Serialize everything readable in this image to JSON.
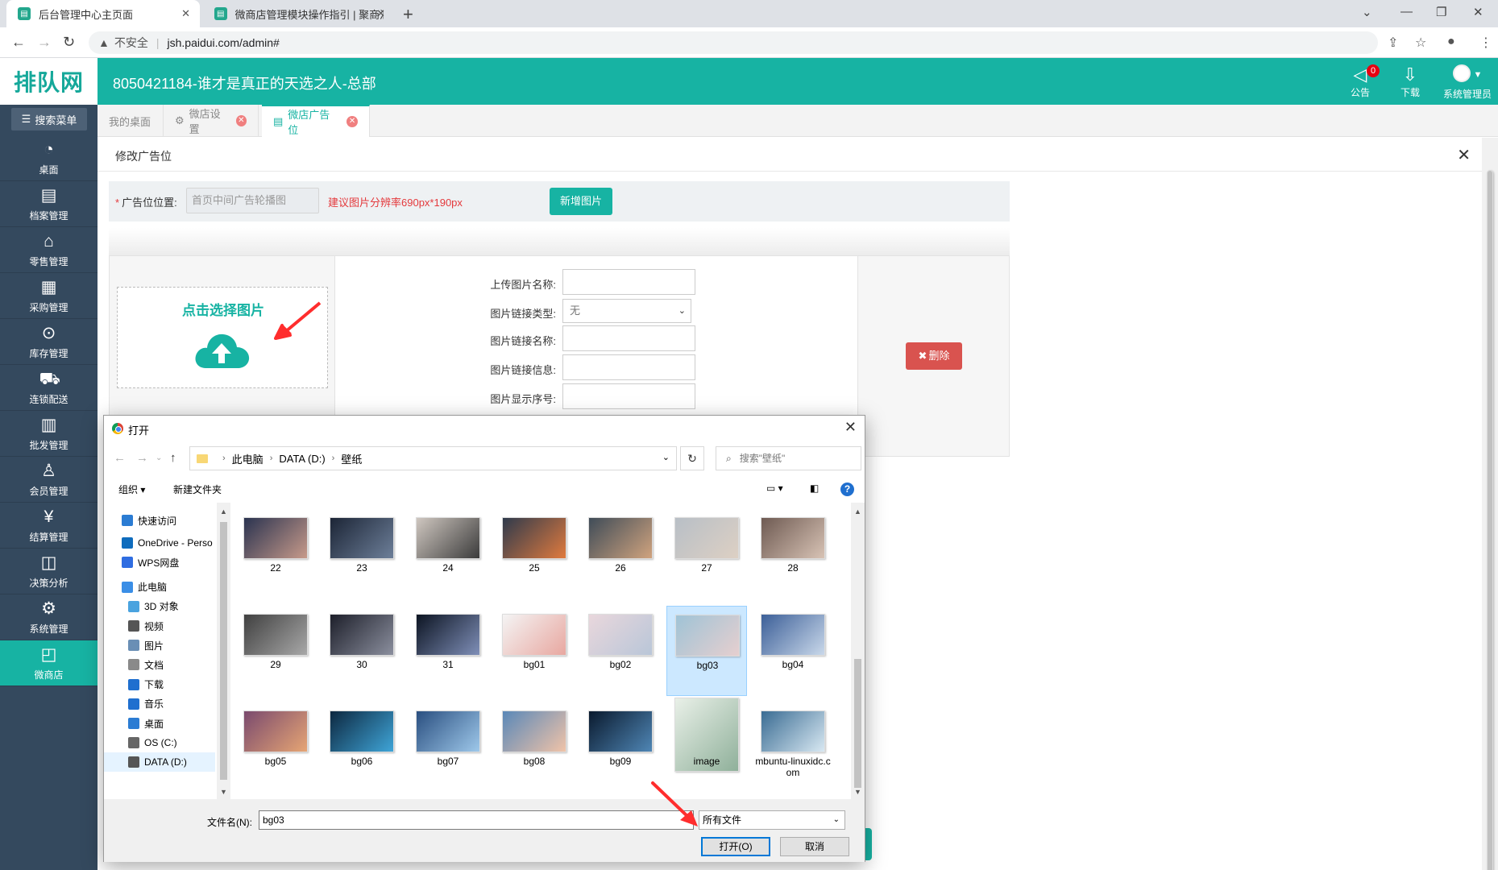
{
  "browser": {
    "tabs": [
      {
        "title": "后台管理中心主页面",
        "active": true
      },
      {
        "title": "微商店管理模块操作指引 | 聚商汇",
        "active": false
      }
    ],
    "new_tab": "+",
    "address": {
      "insecure_label": "不安全",
      "url": "jsh.paidui.com/admin#"
    }
  },
  "app": {
    "logo": "排队网",
    "store_title": "8050421184-谁才是真正的天选之人-总部",
    "header": {
      "notice_label": "公告",
      "notice_count": "0",
      "download_label": "下载",
      "user_label": "系统管理员"
    }
  },
  "sidebar": {
    "search_label": "搜索菜单",
    "items": [
      {
        "label": "桌面",
        "icon": "dashboard-icon",
        "glyph": "◔"
      },
      {
        "label": "档案管理",
        "icon": "archive-icon",
        "glyph": "▤"
      },
      {
        "label": "零售管理",
        "icon": "store-icon",
        "glyph": "⌂"
      },
      {
        "label": "采购管理",
        "icon": "purchase-icon",
        "glyph": "▦"
      },
      {
        "label": "库存管理",
        "icon": "inventory-icon",
        "glyph": "⊙"
      },
      {
        "label": "连锁配送",
        "icon": "delivery-icon",
        "glyph": "⛟"
      },
      {
        "label": "批发管理",
        "icon": "wholesale-icon",
        "glyph": "▥"
      },
      {
        "label": "会员管理",
        "icon": "member-icon",
        "glyph": "♙"
      },
      {
        "label": "结算管理",
        "icon": "settlement-icon",
        "glyph": "¥"
      },
      {
        "label": "决策分析",
        "icon": "analysis-icon",
        "glyph": "◫"
      },
      {
        "label": "系统管理",
        "icon": "settings-icon",
        "glyph": "⚙"
      },
      {
        "label": "微商店",
        "icon": "microstore-icon",
        "glyph": "◰"
      }
    ]
  },
  "content_tabs": [
    {
      "label": "我的桌面",
      "closable": false,
      "icon": ""
    },
    {
      "label": "微店设置",
      "closable": true,
      "icon": "⚙"
    },
    {
      "label": "微店广告位",
      "closable": true,
      "icon": "▤"
    }
  ],
  "panel": {
    "title": "修改广告位",
    "position_label": "广告位位置:",
    "position_value": "首页中间广告轮播图",
    "size_hint": "建议图片分辨率690px*190px",
    "add_button": "新增图片",
    "upload_prompt": "点击选择图片",
    "fields": [
      {
        "label": "上传图片名称:",
        "type": "input",
        "value": ""
      },
      {
        "label": "图片链接类型:",
        "type": "select",
        "value": "无"
      },
      {
        "label": "图片链接名称:",
        "type": "input",
        "value": ""
      },
      {
        "label": "图片链接信息:",
        "type": "input",
        "value": ""
      },
      {
        "label": "图片显示序号:",
        "type": "input",
        "value": ""
      }
    ],
    "delete_button": "删除"
  },
  "dialog": {
    "title": "打开",
    "path": [
      "此电脑",
      "DATA (D:)",
      "壁纸"
    ],
    "search_placeholder": "搜索\"壁纸\"",
    "toolbar": {
      "organize": "组织 ▾",
      "new_folder": "新建文件夹"
    },
    "tree": [
      {
        "label": "快速访问",
        "indent": 1,
        "color": "#2b7cd3",
        "selected": false
      },
      {
        "label": "OneDrive - Perso",
        "indent": 1,
        "color": "#0f6cbd",
        "selected": false
      },
      {
        "label": "WPS网盘",
        "indent": 1,
        "color": "#2f6de1",
        "selected": false
      },
      {
        "label": "此电脑",
        "indent": 1,
        "color": "#3a8ee6",
        "selected": false
      },
      {
        "label": "3D 对象",
        "indent": 2,
        "color": "#4aa3df",
        "selected": false
      },
      {
        "label": "视频",
        "indent": 2,
        "color": "#555555",
        "selected": false
      },
      {
        "label": "图片",
        "indent": 2,
        "color": "#6a8fb5",
        "selected": false
      },
      {
        "label": "文档",
        "indent": 2,
        "color": "#8a8a8a",
        "selected": false
      },
      {
        "label": "下载",
        "indent": 2,
        "color": "#1f6fcf",
        "selected": false
      },
      {
        "label": "音乐",
        "indent": 2,
        "color": "#1f6fcf",
        "selected": false
      },
      {
        "label": "桌面",
        "indent": 2,
        "color": "#2b7cd3",
        "selected": false
      },
      {
        "label": "OS (C:)",
        "indent": 2,
        "color": "#666666",
        "selected": false
      },
      {
        "label": "DATA (D:)",
        "indent": 2,
        "color": "#555555",
        "selected": true
      }
    ],
    "files": [
      {
        "name": "22",
        "c1": "#2a3350",
        "c2": "#c79a8a",
        "selected": false
      },
      {
        "name": "23",
        "c1": "#1c2536",
        "c2": "#6d7f99",
        "selected": false
      },
      {
        "name": "24",
        "c1": "#cfc7c0",
        "c2": "#3b3b3b",
        "selected": false
      },
      {
        "name": "25",
        "c1": "#2f3a4c",
        "c2": "#e07a3e",
        "selected": false
      },
      {
        "name": "26",
        "c1": "#3f4c58",
        "c2": "#d0a37e",
        "selected": false
      },
      {
        "name": "27",
        "c1": "#b8bfc6",
        "c2": "#ddd0c4",
        "selected": false
      },
      {
        "name": "28",
        "c1": "#6e5a52",
        "c2": "#d8c3b5",
        "selected": false
      },
      {
        "name": "29",
        "c1": "#404040",
        "c2": "#a8a8a8",
        "selected": false
      },
      {
        "name": "30",
        "c1": "#1d1f2a",
        "c2": "#8b8f9e",
        "selected": false
      },
      {
        "name": "31",
        "c1": "#0c1422",
        "c2": "#7f8fb8",
        "selected": false
      },
      {
        "name": "bg01",
        "c1": "#f4f4f4",
        "c2": "#e8a7a0",
        "selected": false
      },
      {
        "name": "bg02",
        "c1": "#e9d7dc",
        "c2": "#b9c6d8",
        "selected": false
      },
      {
        "name": "bg03",
        "c1": "#9fc3d6",
        "c2": "#e6cfcf",
        "selected": true
      },
      {
        "name": "bg04",
        "c1": "#3c5f98",
        "c2": "#c9d8ea",
        "selected": false
      },
      {
        "name": "bg05",
        "c1": "#7a4a6e",
        "c2": "#e6a574",
        "selected": false
      },
      {
        "name": "bg06",
        "c1": "#0d2840",
        "c2": "#3fa5d8",
        "selected": false
      },
      {
        "name": "bg07",
        "c1": "#2a4f80",
        "c2": "#9ec8ea",
        "selected": false
      },
      {
        "name": "bg08",
        "c1": "#5a88b8",
        "c2": "#f0c3a8",
        "selected": false
      },
      {
        "name": "bg09",
        "c1": "#0a1a2e",
        "c2": "#4f86b5",
        "selected": false
      },
      {
        "name": "image",
        "c1": "#e9f0e8",
        "c2": "#8fb09a",
        "selected": false
      },
      {
        "name": "mbuntu-linuxidc.com",
        "c1": "#3a6c93",
        "c2": "#d8e8f2",
        "selected": false
      }
    ],
    "filename_label": "文件名(N):",
    "filename_value": "bg03",
    "filetype_value": "所有文件",
    "open_button": "打开(O)",
    "cancel_button": "取消"
  },
  "colors": {
    "brand": "#17b3a3",
    "sidebar": "#34495e",
    "danger": "#d9534f",
    "hint": "#e4393c"
  }
}
